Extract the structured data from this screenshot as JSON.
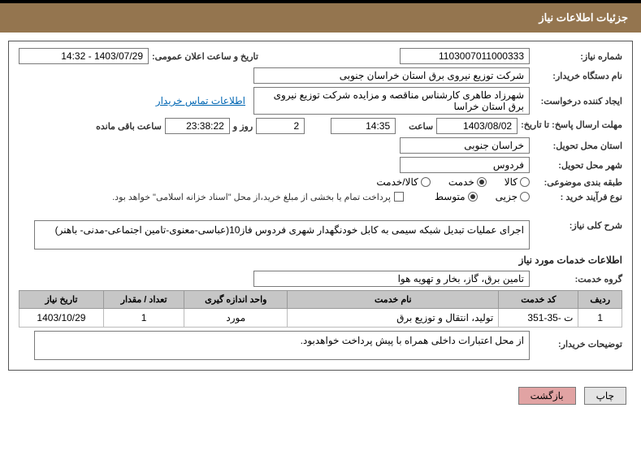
{
  "header": {
    "title": "جزئیات اطلاعات نیاز"
  },
  "fields": {
    "needNo": {
      "label": "شماره نیاز:",
      "value": "1103007011000333"
    },
    "announceDateTime": {
      "label": "تاریخ و ساعت اعلان عمومی:",
      "value": "1403/07/29 - 14:32"
    },
    "buyerOrg": {
      "label": "نام دستگاه خریدار:",
      "value": "شرکت توزیع نیروی برق استان خراسان جنوبی"
    },
    "requestCreator": {
      "label": "ایجاد کننده درخواست:",
      "value": "شهرزاد طاهری کارشناس مناقصه و مزایده شرکت توزیع نیروی برق استان خراسا"
    },
    "buyerContactLink": "اطلاعات تماس خریدار",
    "deadlineDateLabel": "مهلت ارسال پاسخ: تا تاریخ:",
    "deadlineDate": "1403/08/02",
    "timeLabel": "ساعت",
    "deadlineTime": "14:35",
    "remainingDays": "2",
    "remainingDaysSuffix": "روز و",
    "remainingClock": "23:38:22",
    "remainingSuffix": "ساعت باقی مانده",
    "deliveryProvince": {
      "label": "استان محل تحویل:",
      "value": "خراسان جنوبی"
    },
    "deliveryCity": {
      "label": "شهر محل تحویل:",
      "value": "فردوس"
    },
    "subjectCat": {
      "label": "طبقه بندی موضوعی:",
      "optGoods": "کالا",
      "optService": "خدمت",
      "optBoth": "کالا/خدمت"
    },
    "purchaseType": {
      "label": "نوع فرآیند خرید :",
      "optMinor": "جزیی",
      "optMedium": "متوسط"
    },
    "paymentNote": "پرداخت تمام یا بخشی از مبلغ خرید،از محل \"اسناد خزانه اسلامی\" خواهد بود.",
    "overallDescLabel": "شرح کلی نیاز:",
    "overallDesc": "اجرای عملیات تبدیل شبکه سیمی به کابل خودنگهدار شهری فردوس فاز10(عباسی-معنوی-تامین اجتماعی-مدنی- باهنر)",
    "serviceInfoTitle": "اطلاعات خدمات مورد نیاز",
    "serviceGroupLabel": "گروه خدمت:",
    "serviceGroup": "تامین برق، گاز، بخار و تهویه هوا",
    "buyerNotesLabel": "توضیحات خریدار:",
    "buyerNotes": "از محل اعتبارات داخلی همراه با پیش پرداخت خواهدبود."
  },
  "svcTable": {
    "headers": {
      "row": "ردیف",
      "code": "کد خدمت",
      "name": "نام خدمت",
      "unit": "واحد اندازه گیری",
      "qty": "تعداد / مقدار",
      "needDate": "تاریخ نیاز"
    },
    "rows": [
      {
        "idx": "1",
        "code": "ت -35-351",
        "name": "تولید، انتقال و توزیع برق",
        "unit": "مورد",
        "qty": "1",
        "needDate": "1403/10/29"
      }
    ]
  },
  "buttons": {
    "print": "چاپ",
    "back": "بازگشت"
  }
}
